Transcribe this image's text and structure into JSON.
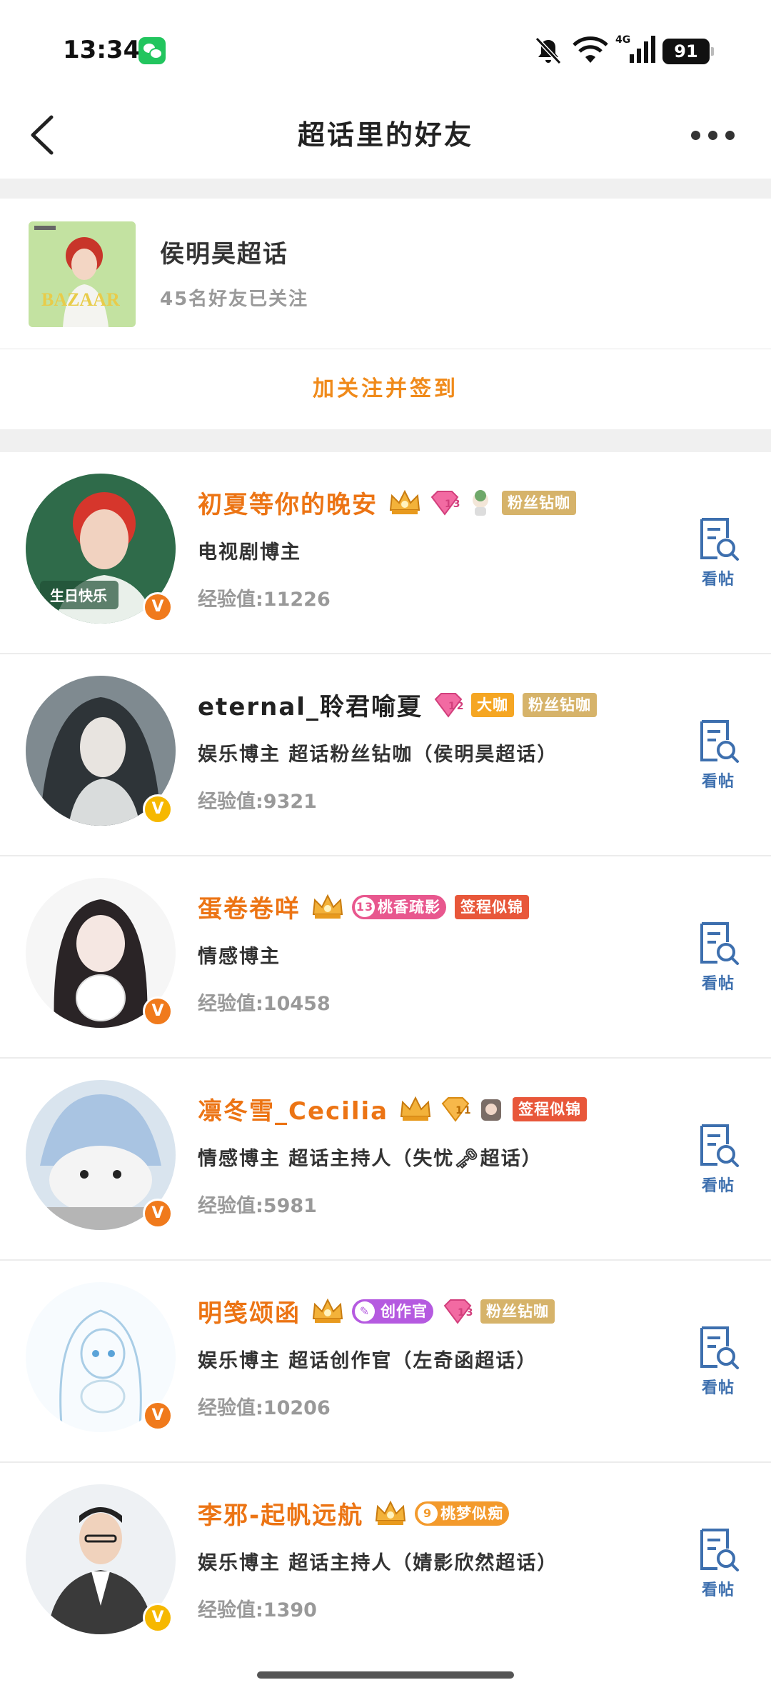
{
  "status_bar": {
    "time": "13:34",
    "battery": "91",
    "network": "4G"
  },
  "nav": {
    "title": "超话里的好友"
  },
  "topic": {
    "name": "侯明昊超话",
    "subtitle": "45名好友已关注",
    "follow_button": "加关注并签到"
  },
  "users": [
    {
      "name": "初夏等你的晚安",
      "name_color": "orange",
      "tags": [
        "粉丝钻咖"
      ],
      "gem_level": "13",
      "desc": "电视剧博主",
      "exp": "经验值:11226",
      "badge": "orange"
    },
    {
      "name": "eternal_聆君喻夏",
      "name_color": "dark",
      "tags": [
        "大咖",
        "粉丝钻咖"
      ],
      "gem_level": "12",
      "desc": "娱乐博主  超话粉丝钻咖（侯明昊超话）",
      "exp": "经验值:9321",
      "badge": "yellow"
    },
    {
      "name": "蛋卷卷咩",
      "name_color": "orange",
      "tags": [
        "桃香疏影",
        "签程似锦"
      ],
      "gem_level": "13",
      "desc": "情感博主",
      "exp": "经验值:10458",
      "badge": "orange"
    },
    {
      "name": "凛冬雪_Cecilia",
      "name_color": "orange",
      "tags": [
        "签程似锦"
      ],
      "gem_level": "11",
      "desc": "情感博主  超话主持人（失忧🗝超话）",
      "exp": "经验值:5981",
      "badge": "orange"
    },
    {
      "name": "明笺颂函",
      "name_color": "orange",
      "tags": [
        "创作官",
        "粉丝钻咖"
      ],
      "gem_level": "13",
      "desc": "娱乐博主  超话创作官（左奇函超话）",
      "exp": "经验值:10206",
      "badge": "orange"
    },
    {
      "name": "李邪-起帆远航",
      "name_color": "orange",
      "tags": [
        "桃梦似痴"
      ],
      "gem_level": "9",
      "desc": "娱乐博主  超话主持人（婧影欣然超话）",
      "exp": "经验值:1390",
      "badge": "yellow"
    }
  ],
  "view_posts_label": "看帖",
  "verified_mark": "V",
  "colors": {
    "accent_orange": "#ec7414",
    "follow_orange": "#f08a1a",
    "link_blue": "#3d6fae",
    "gold_tag": "#d6b36a",
    "red_tag": "#e8573a"
  }
}
